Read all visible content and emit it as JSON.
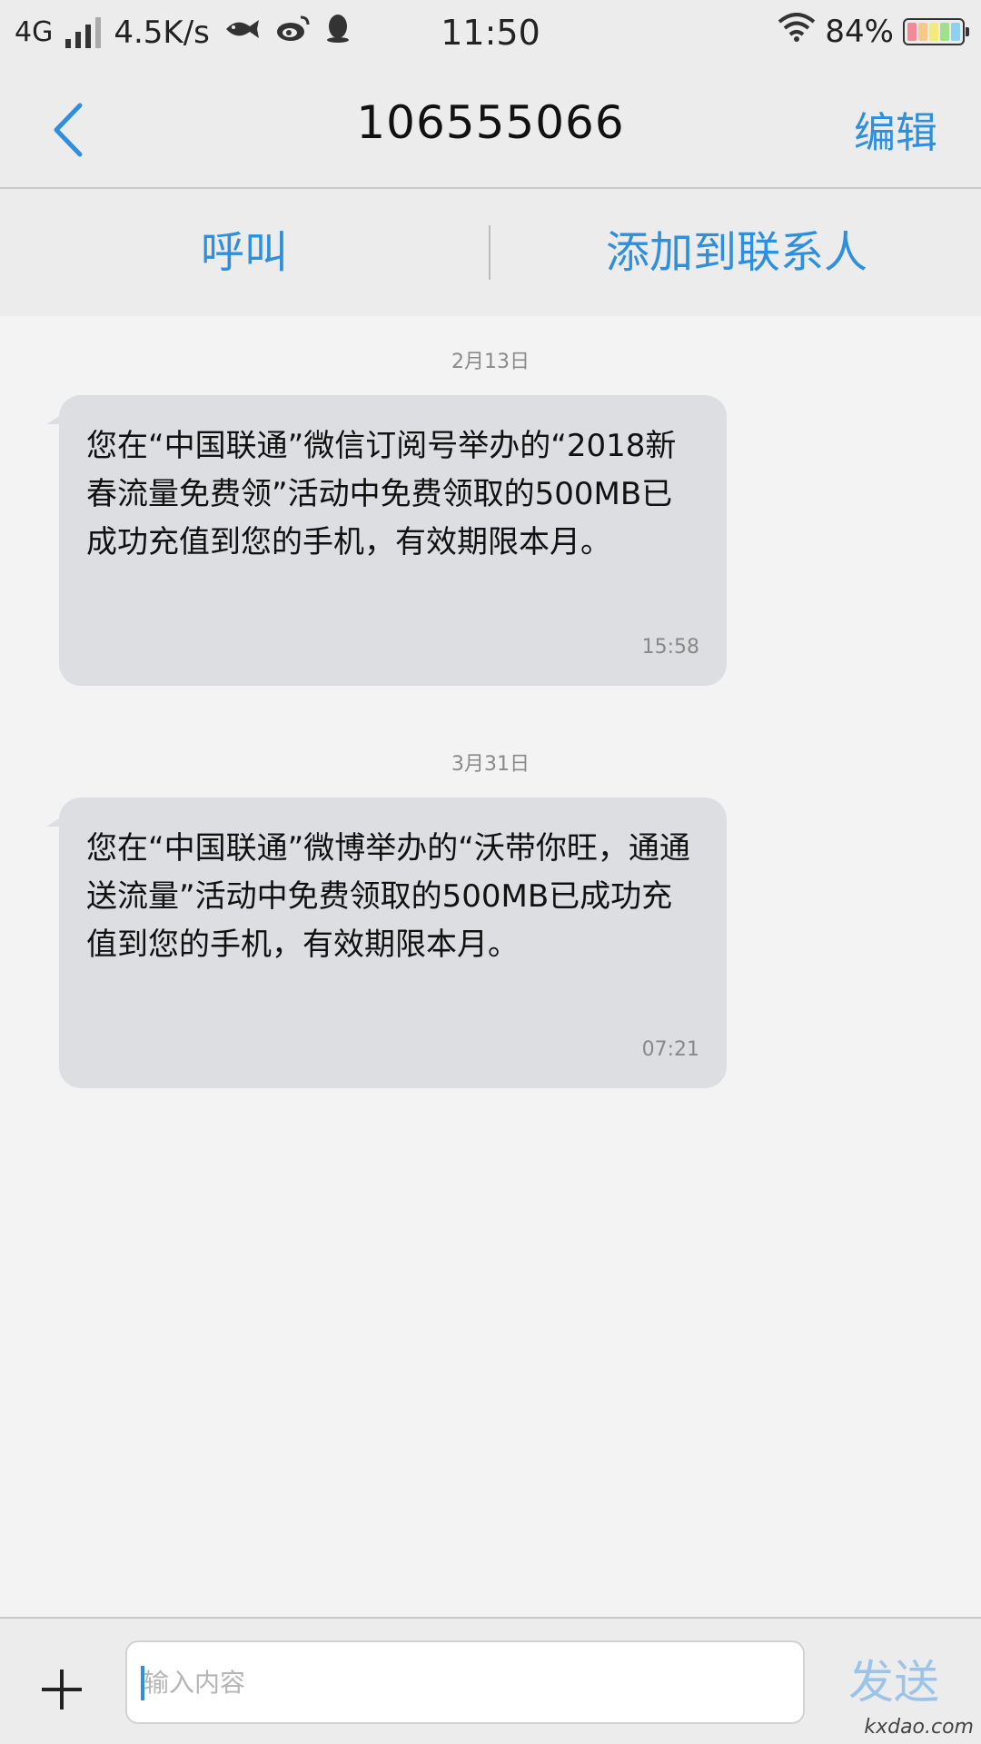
{
  "status_bar": {
    "network": "4G",
    "speed": "4.5K/s",
    "time": "11:50",
    "battery": "84%",
    "icons": [
      "signal-icon",
      "fish-app-icon",
      "weibo-icon",
      "qq-icon",
      "wifi-icon",
      "battery-icon"
    ]
  },
  "nav": {
    "title": "106555066",
    "edit_label": "编辑"
  },
  "actions": {
    "call_label": "呼叫",
    "add_contact_label": "添加到联系人"
  },
  "messages": [
    {
      "date": "2月13日",
      "text": "您在“中国联通”微信订阅号举办的“2018新春流量免费领”活动中免费领取的500MB已成功充值到您的手机，有效期限本月。",
      "time": "15:58"
    },
    {
      "date": "3月31日",
      "text": "您在“中国联通”微博举办的“沃带你旺，通通送流量”活动中免费领取的500MB已成功充值到您的手机，有效期限本月。",
      "time": "07:21"
    }
  ],
  "input": {
    "placeholder": "输入内容",
    "send_label": "发送"
  },
  "watermark": "kxdao.com",
  "colors": {
    "accent": "#2f8fdf",
    "send_disabled": "#9cc4ea",
    "bubble": "#dcdee1",
    "background": "#f3f3f3"
  }
}
